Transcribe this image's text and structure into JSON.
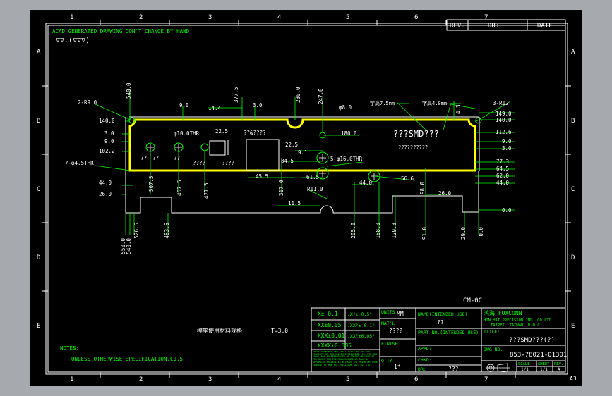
{
  "colors": {
    "background": "#000000",
    "frame": "#ffffff",
    "dimension": "#00ff00",
    "part_outline": "#ffff00",
    "text": "#ffffff",
    "app_backdrop": "#a6aaaf"
  },
  "border": {
    "top_numbers": [
      "1",
      "2",
      "3",
      "4",
      "5",
      "6",
      "7"
    ],
    "bottom_numbers": [
      "1",
      "2",
      "3",
      "4",
      "5",
      "6",
      "7"
    ],
    "left_letters": [
      "A",
      "B",
      "C",
      "D",
      "E"
    ],
    "right_letters": [
      "A",
      "B",
      "C",
      "D",
      "E"
    ],
    "sheet_size": "A3"
  },
  "notes_top": {
    "line1": "ACAD GENERATED DRAWING DON'T CHANGE BY HAND",
    "line2": "▽▽.(▽▽▽)"
  },
  "revision_block": {
    "rev": "REV.",
    "dr": "DR:",
    "date": "DATE"
  },
  "part": {
    "label_cm": "CM-0C",
    "material_note": "模座使用材料规格",
    "thickness": "T=3.0",
    "title_center": "???SMD???",
    "subtitle_center": "??????????",
    "char_height_1": "字高7.5mm",
    "char_height_2": "字高4.0mm",
    "marks": [
      "??",
      "??",
      "??",
      "????",
      "????",
      "??&????"
    ]
  },
  "dimensions_top": [
    "540.0",
    "9.0",
    "14.4",
    "377.5",
    "3.0",
    "230.0",
    "247.0",
    "φ8.0",
    "4.3"
  ],
  "dimensions_left": [
    "2-R9.0",
    "140.0",
    "3.0",
    "9.0",
    "102.2",
    "7-φ4.5THR",
    "44.0",
    "26.0"
  ],
  "dimensions_right": [
    "3-R12",
    "149.0",
    "140.0",
    "112.6",
    "9.0",
    "3.0",
    "77.3",
    "64.5",
    "62.0",
    "44.0",
    "0.0"
  ],
  "dimensions_inner": [
    "φ10.0THR",
    "22.5",
    "180.0",
    "22.5",
    "9.1",
    "84.5",
    "5-φ16.0THR",
    "45.5",
    "61.5",
    "R11.0",
    "11.5",
    "44.0",
    "56.6",
    "26.0",
    "507.5",
    "467.5",
    "427.5",
    "317.0",
    "98.0"
  ],
  "dimensions_bottom": [
    "550.0",
    "540.0",
    "526.5",
    "483.5",
    "205.0",
    "168.0",
    "129.8",
    "91.0",
    "29.0",
    "0.0"
  ],
  "tolerances": {
    "x_1": ".X± 0.1",
    "x_2": ".XX±0.05",
    "x_3": ".XXX±0.01",
    "x_4": ".XXXX±0.005",
    "a_1": ".X°± 0.5°",
    "a_2": ".XX°± 0.1°",
    "a_3": ".XX°±0.05°",
    "disclaimer": "THESE DRAWINGS AND SPECIFICATIONS ARE THE PROPERTY OF HON HAI PRECISION IND. CO. LTD AND SHALL NOT BE REPRODUCED OR COPIED OR USED AS THE BASIS FOR THE MANUFACTURE OR SALE OF APPARATUS OR DEVICES WITHOUT THE PRIOR WRITTEN CONSENT OF HON HAI PRECISION IND. CO. LTD."
  },
  "title_block": {
    "units_label": "UNITS",
    "units_value": "MM",
    "name_label": "NAME(INTENDED USE)",
    "name_value": "??",
    "matl_label": "MAT'L",
    "matl_value": "????",
    "part_no_label": "PART NO.(INTENDED USE)",
    "finish_label": "FINISH",
    "qty_label": "Q'TY",
    "qty_value": "1*",
    "appd_label": "APPD:",
    "chkd_label": "CHKD:",
    "dr_label": "DR:",
    "dr_value": "???",
    "company_logo": "鸿海 FOXCONN",
    "company_name": "HON HAI PRECISION IND. CO.LTD",
    "company_addr": "TAIPEI, TAIWAN, R.O.C",
    "title_label": "TITLE:",
    "title_value": "???SMD???(?)",
    "dwg_label": "DWG NO.",
    "dwg_value": "853-78021-01301",
    "scale_label": "SCALE",
    "scale_value": "1/1",
    "sheet_label": "SHEET",
    "sheet_value": "1/1",
    "rev_label": "REV.",
    "rev_value": "A"
  },
  "notes_bottom": {
    "heading": "NOTES:",
    "line1": "UNLESS OTHERWISE SPECIFICATION,C0.5"
  }
}
